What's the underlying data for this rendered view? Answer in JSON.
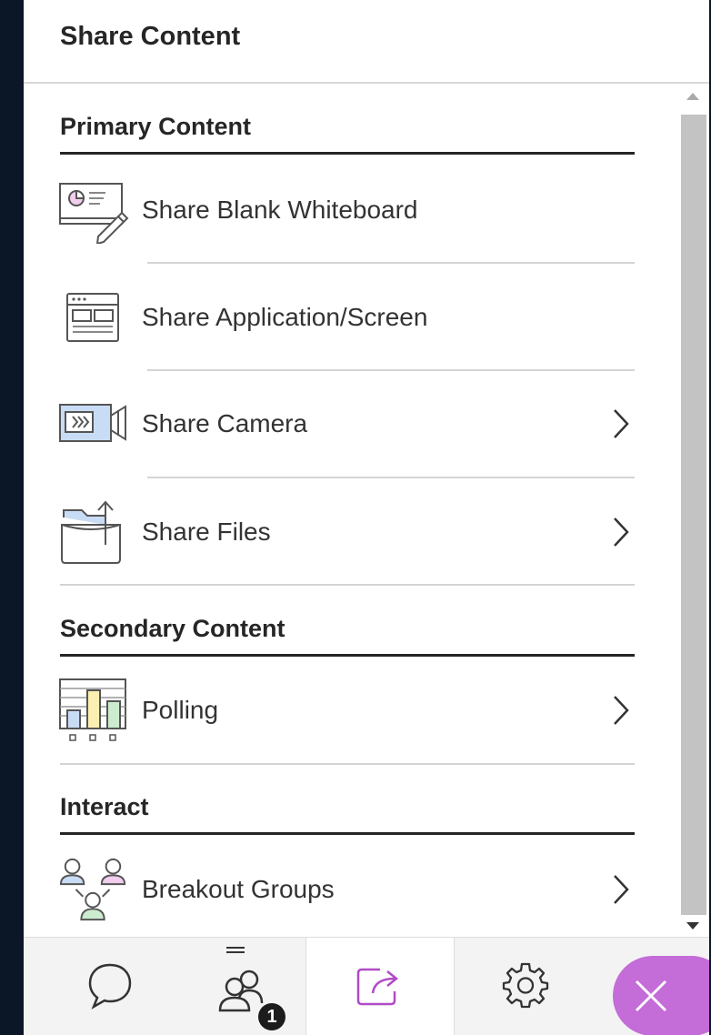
{
  "header": {
    "title": "Share Content"
  },
  "sections": {
    "primary": {
      "title": "Primary Content"
    },
    "secondary": {
      "title": "Secondary Content"
    },
    "interact": {
      "title": "Interact"
    }
  },
  "items": {
    "whiteboard": {
      "label": "Share Blank Whiteboard",
      "icon": "whiteboard-icon"
    },
    "application": {
      "label": "Share Application/Screen",
      "icon": "application-window-icon"
    },
    "camera": {
      "label": "Share Camera",
      "icon": "camera-icon",
      "has_chevron": true
    },
    "files": {
      "label": "Share Files",
      "icon": "folder-upload-icon",
      "has_chevron": true
    },
    "polling": {
      "label": "Polling",
      "icon": "bar-chart-icon",
      "has_chevron": true
    },
    "breakout": {
      "label": "Breakout Groups",
      "icon": "breakout-groups-icon",
      "has_chevron": true
    }
  },
  "footer": {
    "tabs": [
      {
        "name": "chat",
        "icon": "chat-bubble-icon"
      },
      {
        "name": "attendees",
        "icon": "attendees-icon",
        "badge": "1"
      },
      {
        "name": "share-content",
        "icon": "share-icon",
        "active": true
      },
      {
        "name": "settings",
        "icon": "gear-icon"
      }
    ],
    "close_icon": "close-icon"
  },
  "colors": {
    "accent": "#c46cd8",
    "icon_blue": "#c9dcf5",
    "icon_yellow": "#fbefb2",
    "icon_green": "#cdeccf",
    "icon_pink": "#f1cdee",
    "background": "#0b1627"
  }
}
